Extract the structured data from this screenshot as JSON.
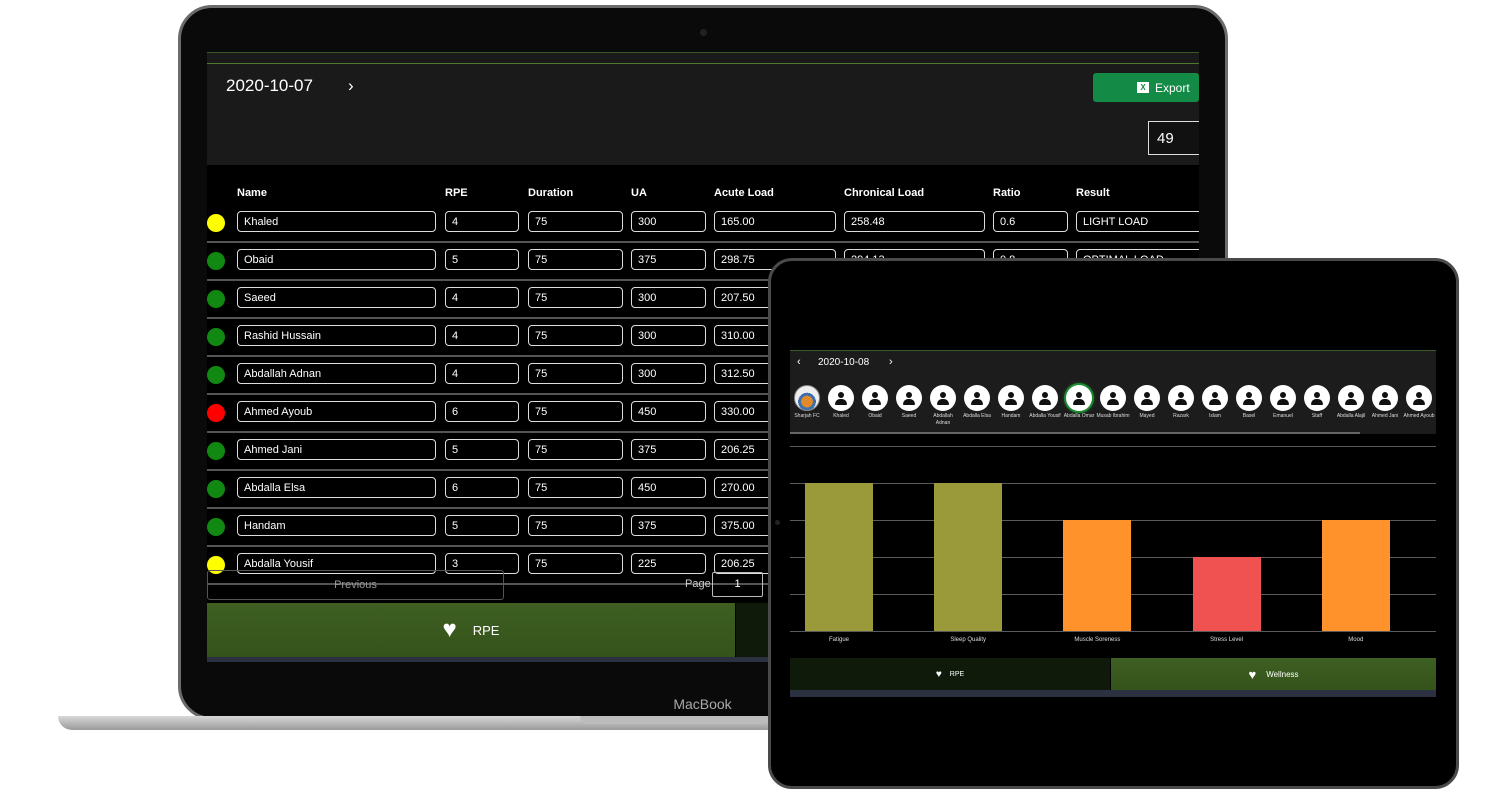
{
  "laptop": {
    "brand": "MacBook",
    "header": {
      "date": "2020-10-07",
      "next_icon": "chevron-right",
      "export_label": "Export",
      "export_icon": "excel-icon",
      "count_value": "49"
    },
    "columns": [
      "Name",
      "RPE",
      "Duration",
      "UA",
      "Acute Load",
      "Chronical Load",
      "Ratio",
      "Result"
    ],
    "rows": [
      {
        "status": "#ffff00",
        "cells": [
          "Khaled",
          "4",
          "75",
          "300",
          "165.00",
          "258.48",
          "0.6",
          "LIGHT LOAD"
        ]
      },
      {
        "status": "#118811",
        "cells": [
          "Obaid",
          "5",
          "75",
          "375",
          "298.75",
          "294.13",
          "0.8",
          "OPTIMAL LOAD"
        ]
      },
      {
        "status": "#118811",
        "cells": [
          "Saeed",
          "4",
          "75",
          "300",
          "207.50",
          "",
          "",
          ""
        ]
      },
      {
        "status": "#118811",
        "cells": [
          "Rashid Hussain",
          "4",
          "75",
          "300",
          "310.00",
          "",
          "",
          ""
        ]
      },
      {
        "status": "#118811",
        "cells": [
          "Abdallah Adnan",
          "4",
          "75",
          "300",
          "312.50",
          "",
          "",
          ""
        ]
      },
      {
        "status": "#ff0000",
        "cells": [
          "Ahmed Ayoub",
          "6",
          "75",
          "450",
          "330.00",
          "",
          "",
          ""
        ]
      },
      {
        "status": "#118811",
        "cells": [
          "Ahmed Jani",
          "5",
          "75",
          "375",
          "206.25",
          "",
          "",
          ""
        ]
      },
      {
        "status": "#118811",
        "cells": [
          "Abdalla Elsa",
          "6",
          "75",
          "450",
          "270.00",
          "",
          "",
          ""
        ]
      },
      {
        "status": "#118811",
        "cells": [
          "Handam",
          "5",
          "75",
          "375",
          "375.00",
          "",
          "",
          ""
        ]
      },
      {
        "status": "#ffff00",
        "cells": [
          "Abdalla Yousif",
          "3",
          "75",
          "225",
          "206.25",
          "",
          "",
          ""
        ]
      }
    ],
    "pagination": {
      "previous_label": "Previous",
      "page_label": "Page",
      "page_value": "1"
    },
    "tabs": [
      {
        "label": "RPE",
        "icon": "heart-pulse",
        "active": true
      },
      {
        "label": "",
        "active": false
      }
    ]
  },
  "tablet": {
    "date": "2020-10-08",
    "players": [
      "Sharjah FC",
      "Khaled",
      "Obaid",
      "Saeed",
      "Abdallah Adnan",
      "Abdalla Elsa",
      "Handam",
      "Abdalla Yousif",
      "Abdalla Omar",
      "Musab Ibrahim",
      "Mayed",
      "Razark",
      "Islam",
      "Basel",
      "Emanuel",
      "Staff",
      "Abdalla Alajil",
      "Ahmed Jani",
      "Ahmed Ayoub"
    ],
    "selected_player": "Abdalla Omar",
    "tabs": [
      {
        "label": "RPE",
        "icon": "heart-pulse",
        "active": false
      },
      {
        "label": "Wellness",
        "icon": "heart-pulse",
        "active": true
      }
    ]
  },
  "chart_data": {
    "type": "bar",
    "categories": [
      "Fatigue",
      "Sleep Quality",
      "Muscle Soreness",
      "Stress Level",
      "Mood"
    ],
    "values": [
      4,
      4,
      3,
      2,
      3
    ],
    "colors": [
      "#9a9a3a",
      "#9a9a3a",
      "#ff922b",
      "#f05252",
      "#ff922b"
    ],
    "ylim": [
      0,
      5
    ],
    "grid": true,
    "xlabel": "",
    "ylabel": ""
  }
}
